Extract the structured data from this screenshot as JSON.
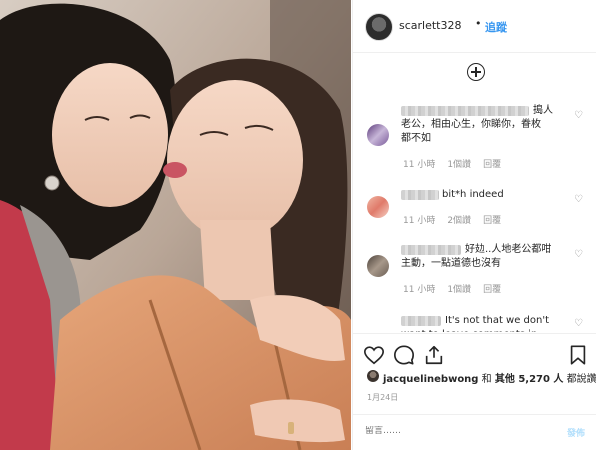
{
  "header": {
    "username": "scarlett328",
    "separator": "•",
    "follow_label": "追蹤"
  },
  "load_more": {
    "icon": "plus-circle-icon"
  },
  "comments": [
    {
      "text": "搗人\n老公，相由心生，你睇你，眷枚\n都不如",
      "time": "11 小時",
      "likes": "1個讚",
      "reply": "回覆"
    },
    {
      "text": "bit*h indeed",
      "time": "11 小時",
      "likes": "2個讚",
      "reply": "回覆"
    },
    {
      "text": "好攰..人地老公都咁\n主動，一點道德也沒有",
      "time": "11 小時",
      "likes": "1個讚",
      "reply": "回覆"
    },
    {
      "text": "It's not that we don't\nwant to leave comments in"
    }
  ],
  "actions": {
    "like_icon": "heart-icon",
    "comment_icon": "comment-icon",
    "share_icon": "share-icon",
    "save_icon": "bookmark-icon"
  },
  "likes": {
    "user": "jacquelinebwong",
    "and": "和",
    "others": "其他 5,270 人",
    "suffix": "都說讚"
  },
  "date": "1月24日",
  "comment_box": {
    "placeholder": "留言……",
    "post_label": "發佈"
  },
  "colors": {
    "link_blue": "#3897f0",
    "post_disabled": "#b2dffc",
    "meta_gray": "#999999"
  }
}
